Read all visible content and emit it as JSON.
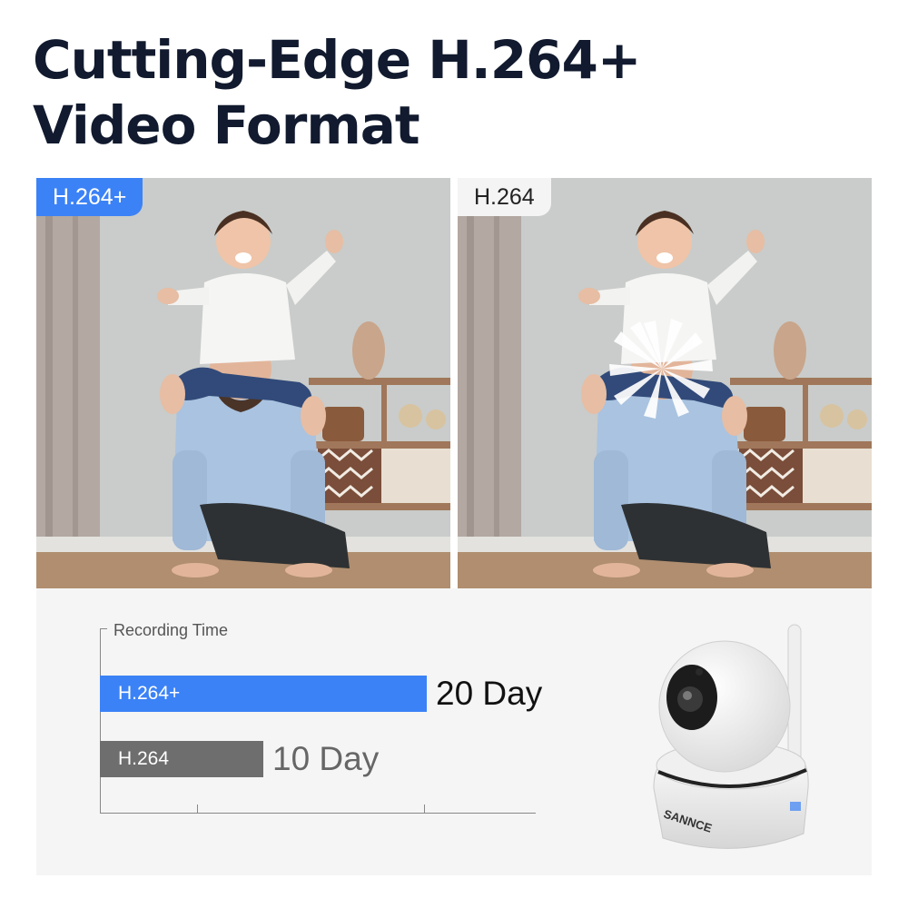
{
  "headline": {
    "line1": "Cutting-Edge H.264+",
    "line2": "Video Format"
  },
  "photos": {
    "left": {
      "tag": "H.264+"
    },
    "right": {
      "tag": "H.264"
    }
  },
  "recording_chart": {
    "axis_title": "Recording Time",
    "max_days": 30,
    "bars": [
      {
        "label": "H.264+",
        "days": 20,
        "value_text": "20 Day",
        "color": "#3b82f6"
      },
      {
        "label": "H.264",
        "days": 10,
        "value_text": "10 Day",
        "color": "#6e6e6e"
      }
    ]
  },
  "camera": {
    "brand": "SANNCE"
  }
}
